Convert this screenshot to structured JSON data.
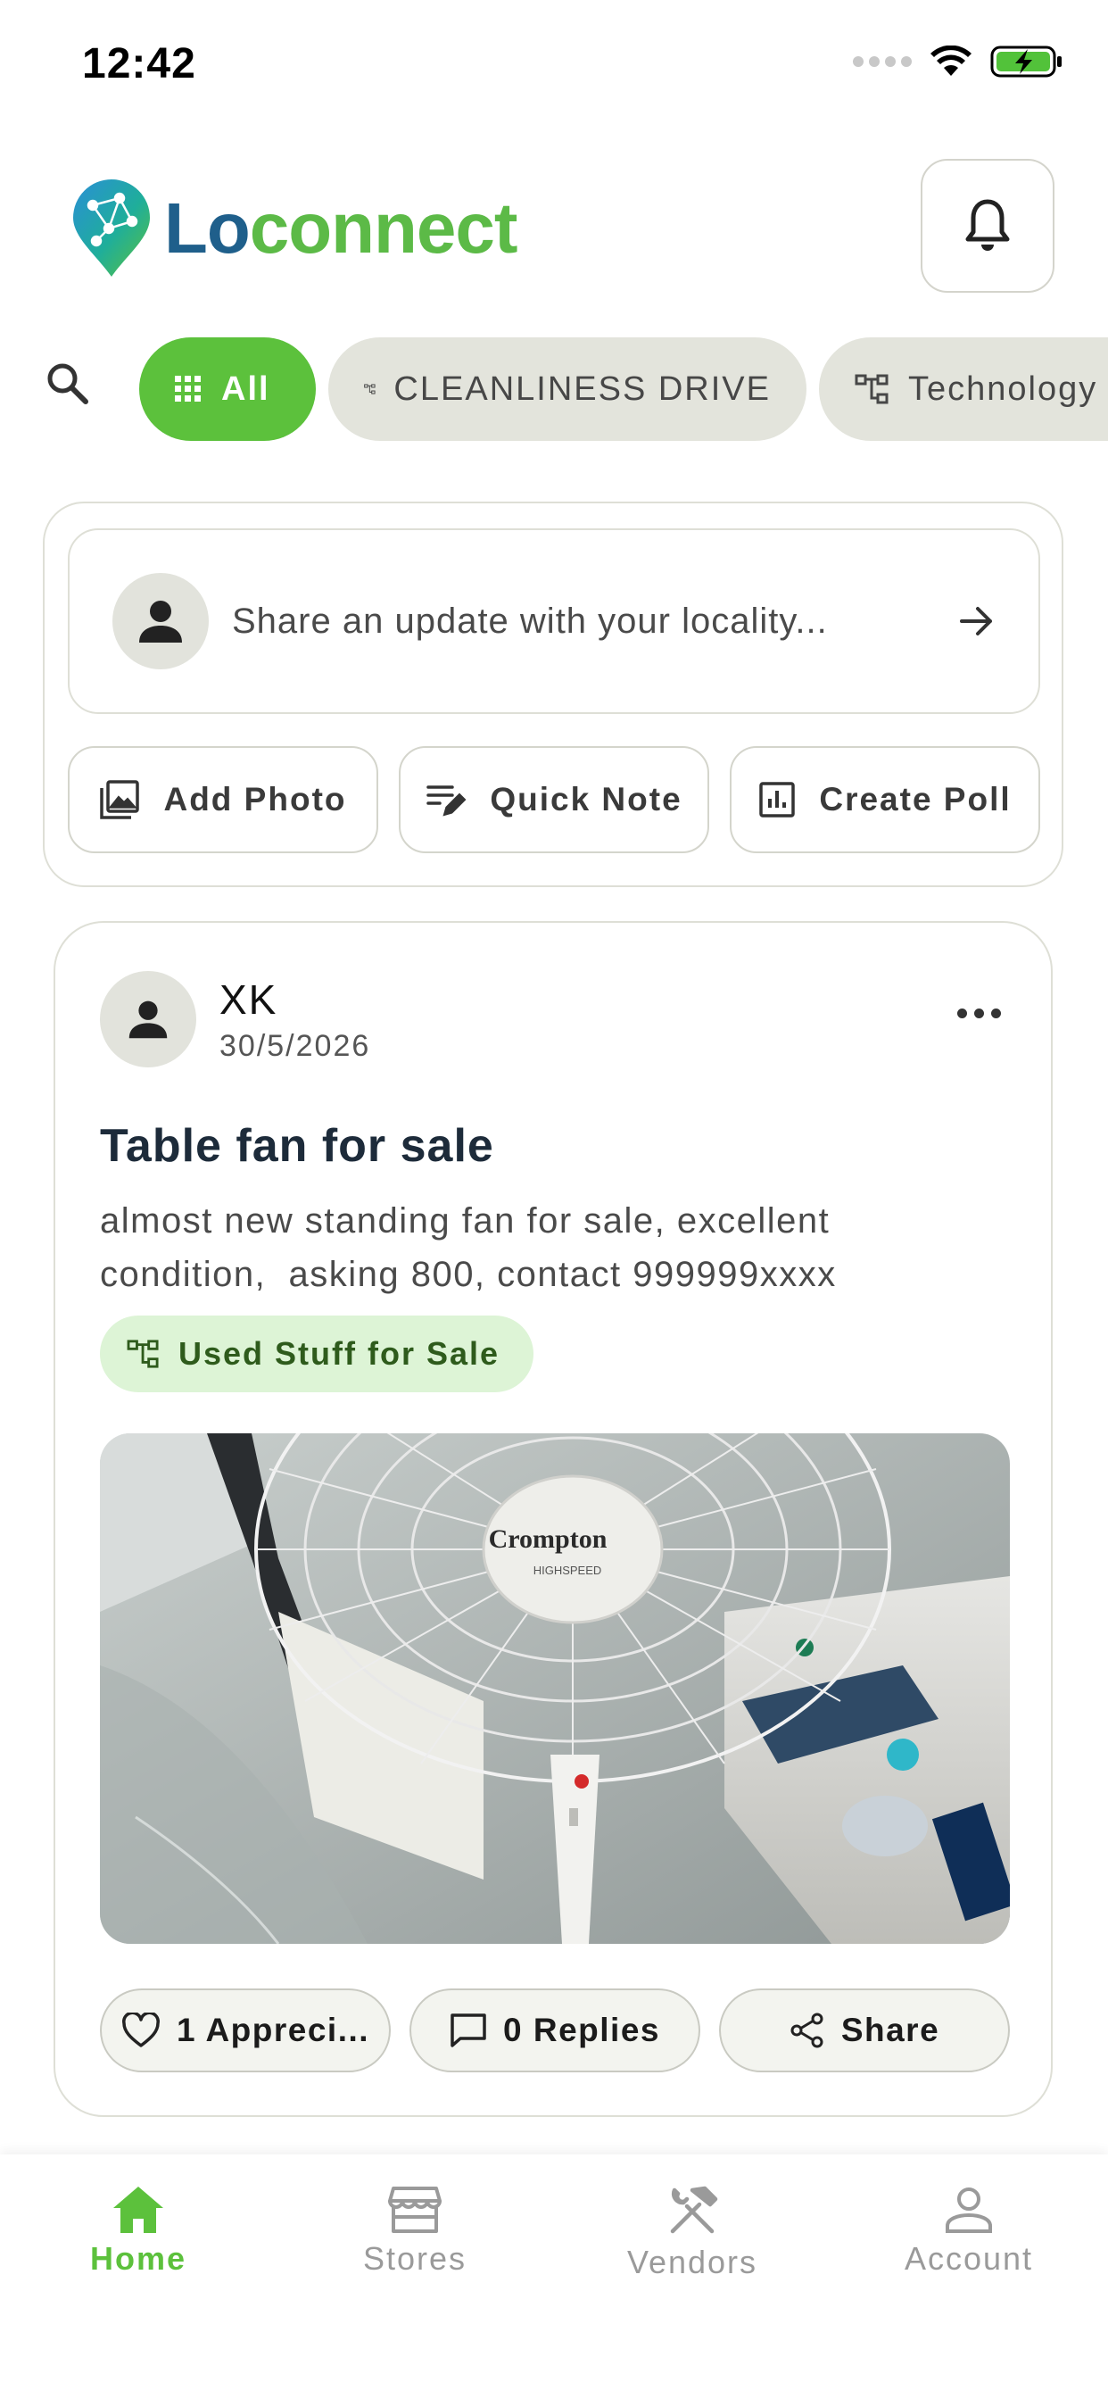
{
  "status_bar": {
    "time": "12:42"
  },
  "header": {
    "logo_part1": "Lo",
    "logo_part2": "connect"
  },
  "categories": {
    "items": [
      {
        "label": "All",
        "icon": "grid-icon",
        "active": true
      },
      {
        "label": "CLEANLINESS DRIVE",
        "icon": "category-tree-icon",
        "active": false
      },
      {
        "label": "Technology",
        "icon": "category-tree-icon",
        "active": false
      }
    ]
  },
  "composer": {
    "placeholder": "Share an update with your locality...",
    "actions": [
      {
        "label": "Add Photo",
        "icon": "image-icon"
      },
      {
        "label": "Quick Note",
        "icon": "edit-note-icon"
      },
      {
        "label": "Create Poll",
        "icon": "poll-icon"
      }
    ]
  },
  "post": {
    "author": "XK",
    "date": "30/5/2026",
    "title": "Table fan for sale",
    "body": "almost new standing fan for sale, excellent\ncondition,  asking 800, contact 999999xxxx",
    "tag": "Used Stuff for Sale",
    "image_brand": "Crompton",
    "image_model": "HIGHSPEED",
    "actions": {
      "appreciate": "1 Appreci...",
      "replies": "0 Replies",
      "share": "Share"
    }
  },
  "bottom_nav": {
    "items": [
      {
        "label": "Home",
        "icon": "home-icon",
        "active": true
      },
      {
        "label": "Stores",
        "icon": "store-icon",
        "active": false
      },
      {
        "label": "Vendors",
        "icon": "tools-icon",
        "active": false
      },
      {
        "label": "Account",
        "icon": "person-icon",
        "active": false
      }
    ]
  },
  "colors": {
    "brand_green": "#5cc13c",
    "brand_blue": "#1f5f8b",
    "chip_bg": "#e3e4dc",
    "tag_bg": "#ddf4d6"
  }
}
